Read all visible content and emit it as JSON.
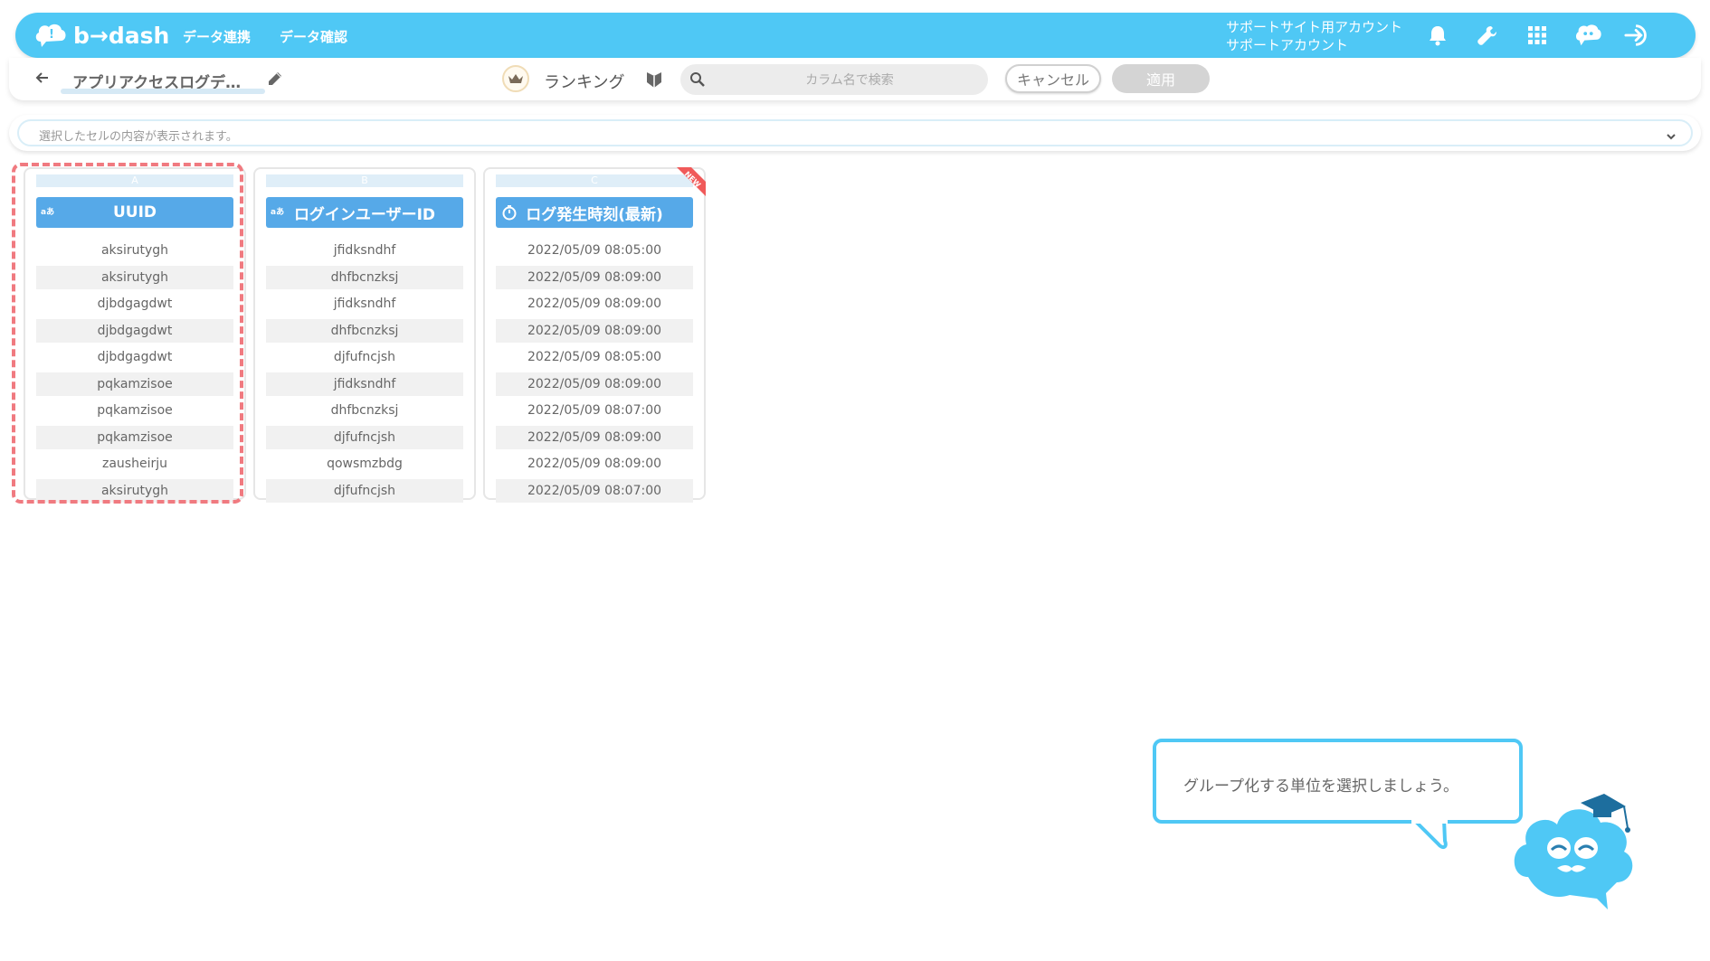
{
  "header": {
    "logo_text": "b→dash",
    "nav": [
      "データ連携",
      "データ確認"
    ],
    "account_line1": "サポートサイト用アカウント",
    "account_line2": "サポートアカウント",
    "icons": [
      "bell-icon",
      "wrench-icon",
      "apps-grid-icon",
      "chat-bot-icon",
      "logout-icon"
    ],
    "accent": "#4fc8f5"
  },
  "toolbar": {
    "report_title": "アプリアクセスログデ…",
    "ranking_label": "ランキング",
    "search_placeholder": "カラム名で検索",
    "cancel_label": "キャンセル",
    "apply_label": "適用"
  },
  "cell_bar": {
    "placeholder": "選択したセルの内容が表示されます。"
  },
  "columns": [
    {
      "letter": "A",
      "type_badge": "aあ",
      "header": "UUID",
      "selected": true,
      "rows": [
        "aksirutygh",
        "aksirutygh",
        "djbdgagdwt",
        "djbdgagdwt",
        "djbdgagdwt",
        "pqkamzisoe",
        "pqkamzisoe",
        "pqkamzisoe",
        "zausheirju",
        "aksirutygh"
      ]
    },
    {
      "letter": "B",
      "type_badge": "aあ",
      "header": "ログインユーザーID",
      "selected": false,
      "rows": [
        "jfidksndhf",
        "dhfbcnzksj",
        "jfidksndhf",
        "dhfbcnzksj",
        "djfufncjsh",
        "jfidksndhf",
        "dhfbcnzksj",
        "djfufncjsh",
        "qowsmzbdg",
        "djfufncjsh"
      ]
    },
    {
      "letter": "C",
      "type_badge": "timer-icon",
      "header": "ログ発生時刻(最新)",
      "badge": "NEW",
      "selected": false,
      "rows": [
        "2022/05/09 08:05:00",
        "2022/05/09 08:09:00",
        "2022/05/09 08:09:00",
        "2022/05/09 08:09:00",
        "2022/05/09 08:05:00",
        "2022/05/09 08:09:00",
        "2022/05/09 08:07:00",
        "2022/05/09 08:09:00",
        "2022/05/09 08:09:00",
        "2022/05/09 08:07:00"
      ]
    }
  ],
  "tooltip": {
    "text": "グループ化する単位を選択しましょう。"
  },
  "colors": {
    "header_blue": "#56a9e8",
    "selection_dash": "#f07a80",
    "new_ribbon": "#f05a5a"
  }
}
